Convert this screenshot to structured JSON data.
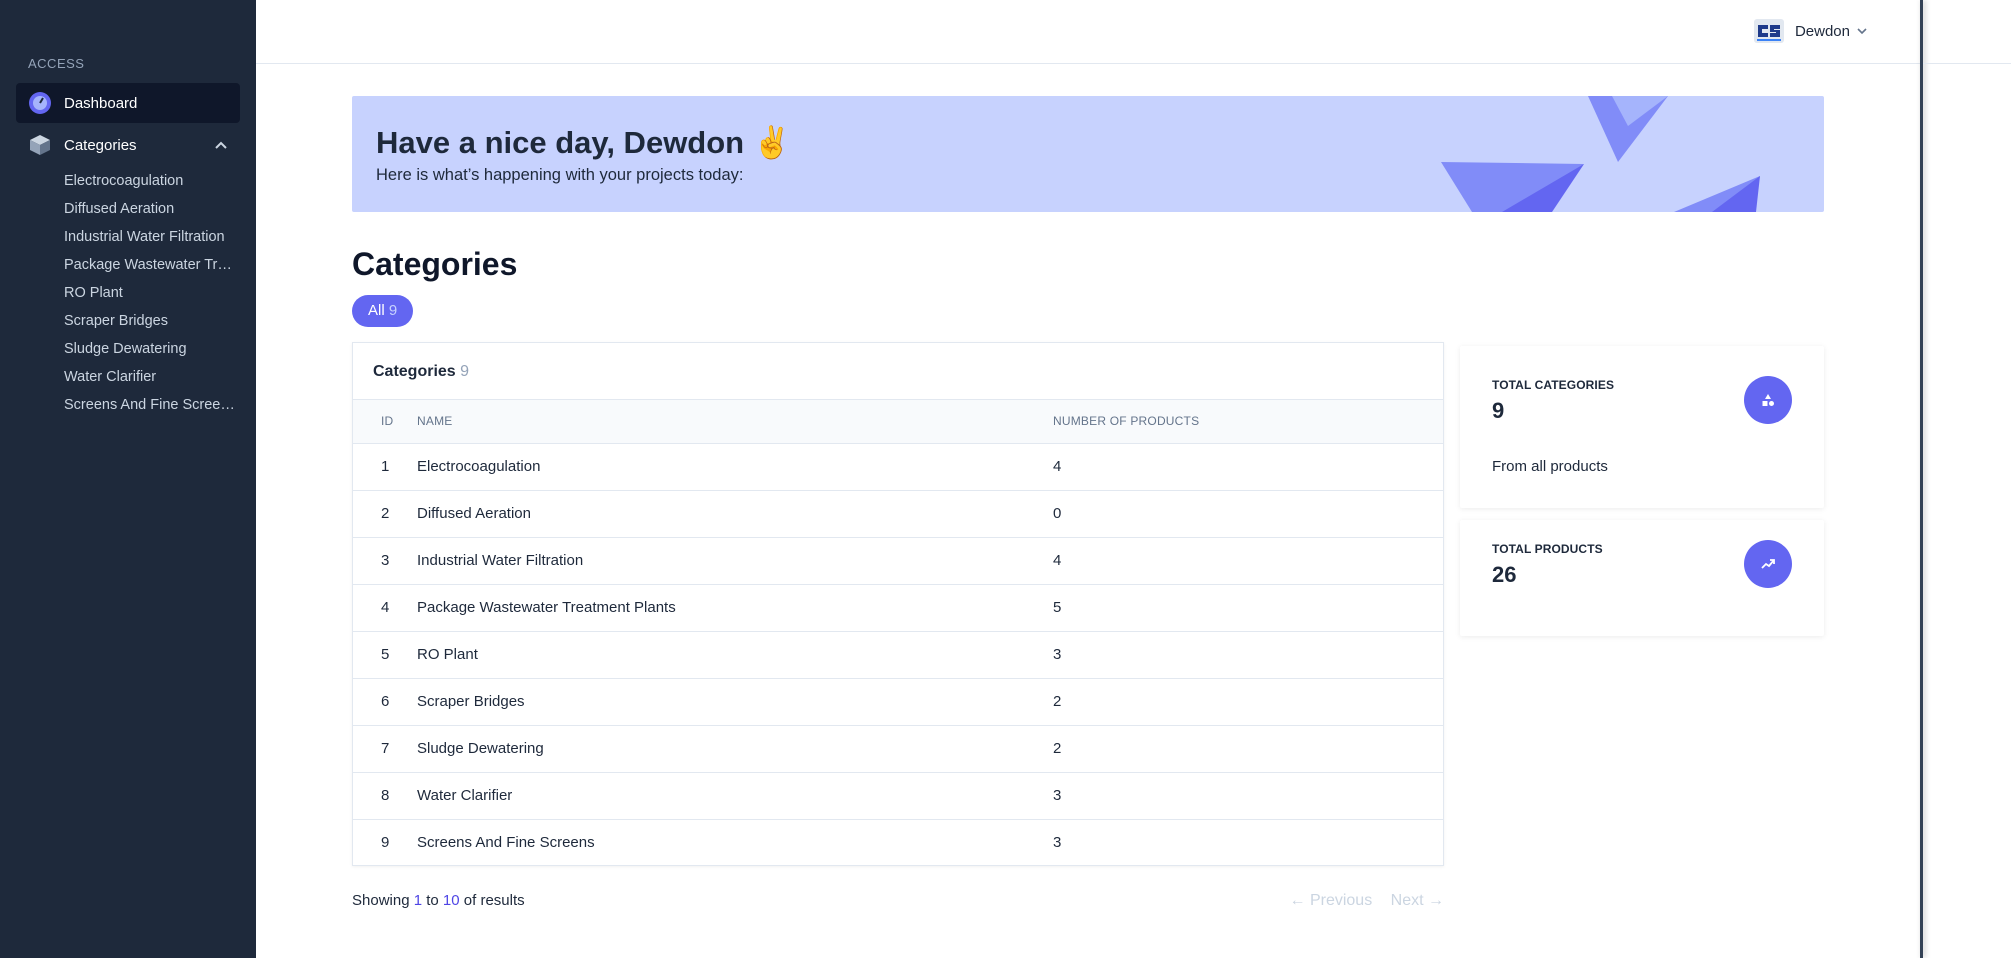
{
  "sidebar": {
    "section_label": "ACCESS",
    "dashboard_label": "Dashboard",
    "categories_label": "Categories",
    "items": [
      "Electrocoagulation",
      "Diffused Aeration",
      "Industrial Water Filtration",
      "Package Wastewater Tr…",
      "RO Plant",
      "Scraper Bridges",
      "Sludge Dewatering",
      "Water Clarifier",
      "Screens And Fine Scree…"
    ]
  },
  "header": {
    "user_name": "Dewdon"
  },
  "banner": {
    "title": "Have a nice day, Dewdon ✌️",
    "subtitle": "Here is what’s happening with your projects today:"
  },
  "page": {
    "title": "Categories",
    "filter_label": "All",
    "filter_count": "9"
  },
  "table": {
    "title": "Categories",
    "count": "9",
    "columns": [
      "ID",
      "NAME",
      "NUMBER OF PRODUCTS"
    ],
    "rows": [
      {
        "id": "1",
        "name": "Electrocoagulation",
        "products": "4"
      },
      {
        "id": "2",
        "name": "Diffused Aeration",
        "products": "0"
      },
      {
        "id": "3",
        "name": "Industrial Water Filtration",
        "products": "4"
      },
      {
        "id": "4",
        "name": "Package Wastewater Treatment Plants",
        "products": "5"
      },
      {
        "id": "5",
        "name": "RO Plant",
        "products": "3"
      },
      {
        "id": "6",
        "name": "Scraper Bridges",
        "products": "2"
      },
      {
        "id": "7",
        "name": "Sludge Dewatering",
        "products": "2"
      },
      {
        "id": "8",
        "name": "Water Clarifier",
        "products": "3"
      },
      {
        "id": "9",
        "name": "Screens And Fine Screens",
        "products": "3"
      }
    ]
  },
  "pagination": {
    "showing": "Showing",
    "from": "1",
    "to_word": "to",
    "to": "10",
    "of_results": "of results",
    "previous": "← Previous",
    "next": "Next →"
  },
  "stats": {
    "categories": {
      "label": "TOTAL CATEGORIES",
      "value": "9",
      "sub": "From all products",
      "icon": "shapes-icon"
    },
    "products": {
      "label": "TOTAL PRODUCTS",
      "value": "26",
      "icon": "trending-up-icon"
    }
  },
  "colors": {
    "sidebar_bg": "#1e293b",
    "accent": "#6366f1",
    "banner_bg": "#c7d2fe"
  }
}
